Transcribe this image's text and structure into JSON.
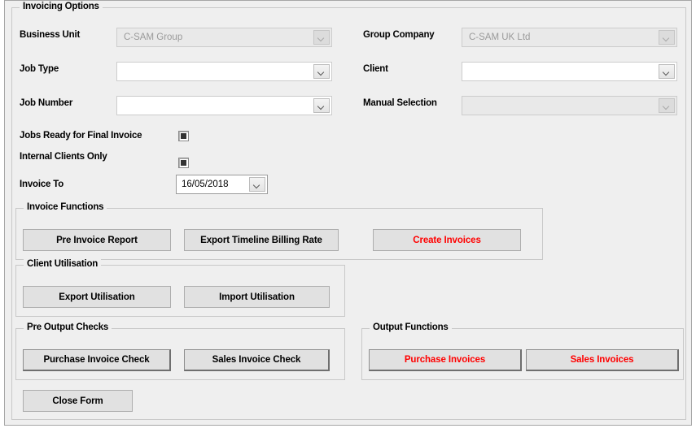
{
  "window": {
    "title": "Invoicing Options"
  },
  "groups": {
    "invoicing_options": "Invoicing Options",
    "invoice_functions": "Invoice Functions",
    "client_utilisation": "Client Utilisation",
    "pre_output_checks": "Pre Output Checks",
    "output_functions": "Output Functions"
  },
  "fields": {
    "business_unit": {
      "label": "Business Unit",
      "value": "C-SAM Group",
      "enabled": false
    },
    "job_type": {
      "label": "Job Type",
      "value": "",
      "enabled": true
    },
    "job_number": {
      "label": "Job Number",
      "value": "",
      "enabled": true
    },
    "group_company": {
      "label": "Group Company",
      "value": "C-SAM UK Ltd",
      "enabled": false
    },
    "client": {
      "label": "Client",
      "value": "",
      "enabled": true
    },
    "manual_selection": {
      "label": "Manual Selection",
      "value": "",
      "enabled": false
    },
    "jobs_ready_for_final_invoice": {
      "label": "Jobs Ready for Final Invoice",
      "checked": true
    },
    "internal_clients_only": {
      "label": "Internal Clients Only",
      "checked": true
    },
    "invoice_to": {
      "label": "Invoice To",
      "value": "16/05/2018"
    }
  },
  "buttons": {
    "pre_invoice_report": "Pre Invoice Report",
    "export_timeline_billing_rate": "Export Timeline Billing Rate",
    "create_invoices": "Create Invoices",
    "export_utilisation": "Export Utilisation",
    "import_utilisation": "Import Utilisation",
    "purchase_invoice_check": "Purchase Invoice Check",
    "sales_invoice_check": "Sales Invoice Check",
    "purchase_invoices": "Purchase Invoices",
    "sales_invoices": "Sales Invoices",
    "close_form": "Close Form"
  },
  "colors": {
    "accent_red": "#ff0000",
    "window_background": "#efefef",
    "button_face": "#e1e1e1",
    "disabled_field": "#e9e9e9",
    "disabled_text": "#9a9a9a"
  },
  "icons": {
    "combo_chevron": "chevron-down-icon",
    "checkbox_mark": "filled-square-icon"
  }
}
